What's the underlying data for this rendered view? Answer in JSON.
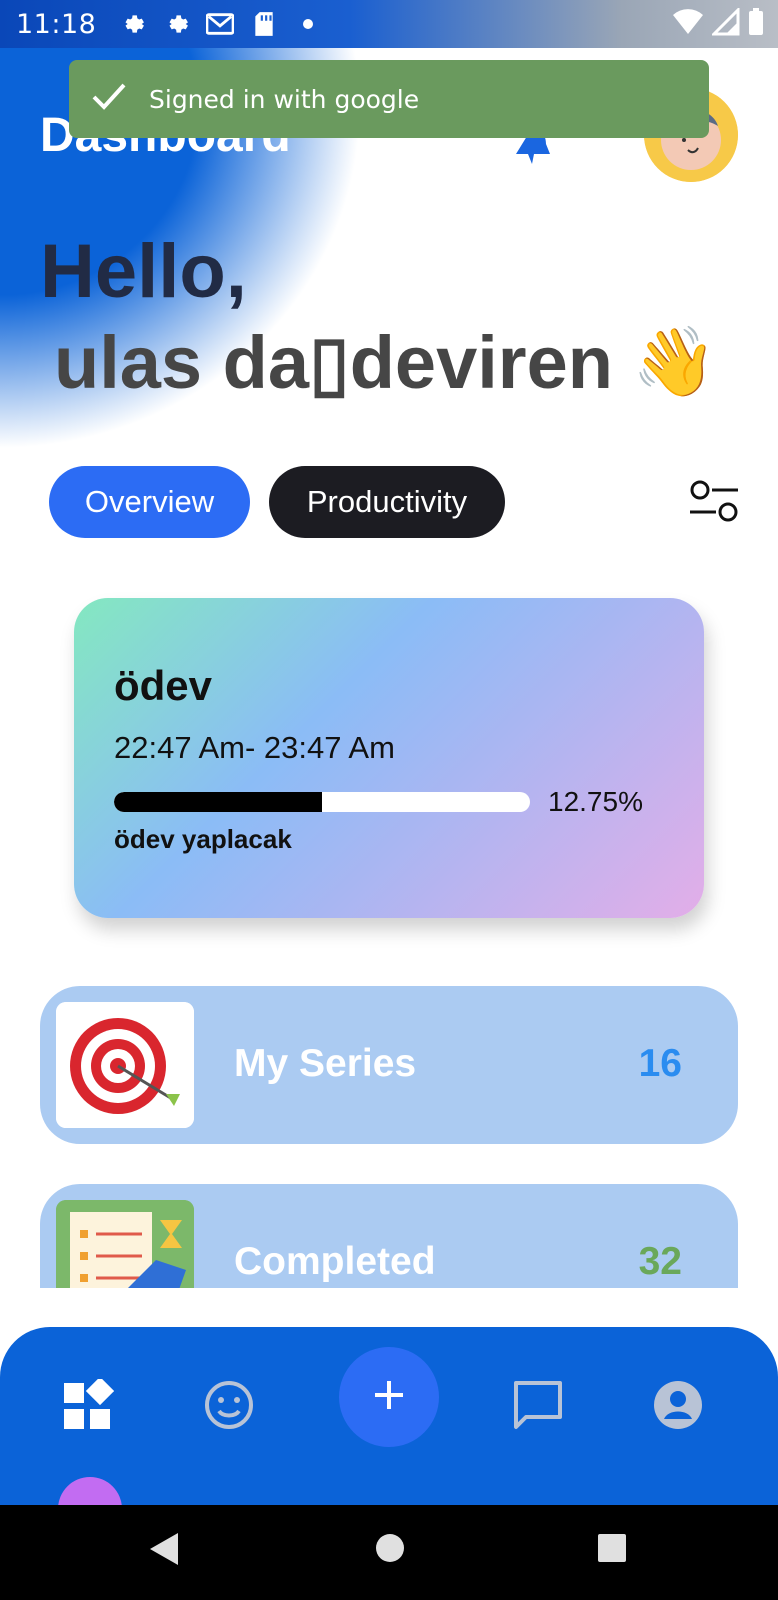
{
  "status_bar": {
    "time": "11:18"
  },
  "toast": {
    "message": "Signed in with google"
  },
  "header": {
    "title": "Dashboard"
  },
  "greeting": {
    "hello": "Hello,",
    "name": "ulas da▯deviren",
    "emoji": "👋"
  },
  "tabs": [
    {
      "label": "Overview"
    },
    {
      "label": "Productivity"
    }
  ],
  "task_card": {
    "title": "ödev",
    "time": "22:47 Am- 23:47 Am",
    "progress_label": "12.75%",
    "progress_fraction": 0.5,
    "description": "ödev yaplacak"
  },
  "stats": [
    {
      "label": "My Series",
      "count": "16",
      "count_color": "#2a8cf0",
      "icon": "target-icon"
    },
    {
      "label": "Completed",
      "count": "32",
      "count_color": "#6aa85a",
      "icon": "checklist-icon"
    }
  ],
  "colors": {
    "primary_blue": "#0b63d8",
    "accent_blue": "#2c6cf4",
    "toast_green": "#6a9a5e",
    "card_bg": "#abcbf2"
  }
}
